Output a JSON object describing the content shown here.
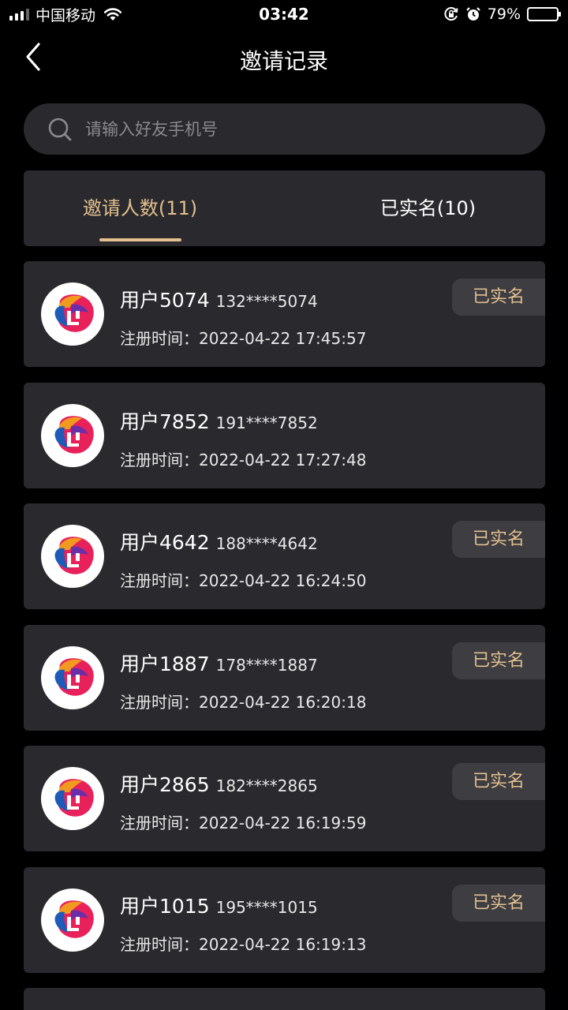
{
  "status_bar": {
    "carrier": "中国移动",
    "time": "03:42",
    "battery_percent": "79%",
    "battery_level": 0.79,
    "battery_color": "#f5c518",
    "icons": [
      "signal-icon",
      "wifi-icon",
      "orientation-lock-icon",
      "alarm-icon",
      "battery-icon"
    ]
  },
  "nav": {
    "title": "邀请记录",
    "back_icon": "chevron-left-icon"
  },
  "search": {
    "placeholder": "请输入好友手机号",
    "value": ""
  },
  "tabs": [
    {
      "label": "邀请人数(11)",
      "active": true
    },
    {
      "label": "已实名(10)",
      "active": false
    }
  ],
  "colors": {
    "accent": "#e3c08f",
    "card_bg": "#2a2a2e",
    "badge_bg": "#3d3d42",
    "background": "#000000"
  },
  "records": [
    {
      "name": "用户5074",
      "phone": "132****5074",
      "time_label": "注册时间：",
      "time": "2022-04-22 17:45:57",
      "badge": "已实名"
    },
    {
      "name": "用户7852",
      "phone": "191****7852",
      "time_label": "注册时间：",
      "time": "2022-04-22 17:27:48",
      "badge": ""
    },
    {
      "name": "用户4642",
      "phone": "188****4642",
      "time_label": "注册时间：",
      "time": "2022-04-22 16:24:50",
      "badge": "已实名"
    },
    {
      "name": "用户1887",
      "phone": "178****1887",
      "time_label": "注册时间：",
      "time": "2022-04-22 16:20:18",
      "badge": "已实名"
    },
    {
      "name": "用户2865",
      "phone": "182****2865",
      "time_label": "注册时间：",
      "time": "2022-04-22 16:19:59",
      "badge": "已实名"
    },
    {
      "name": "用户1015",
      "phone": "195****1015",
      "time_label": "注册时间：",
      "time": "2022-04-22 16:19:13",
      "badge": "已实名"
    }
  ]
}
